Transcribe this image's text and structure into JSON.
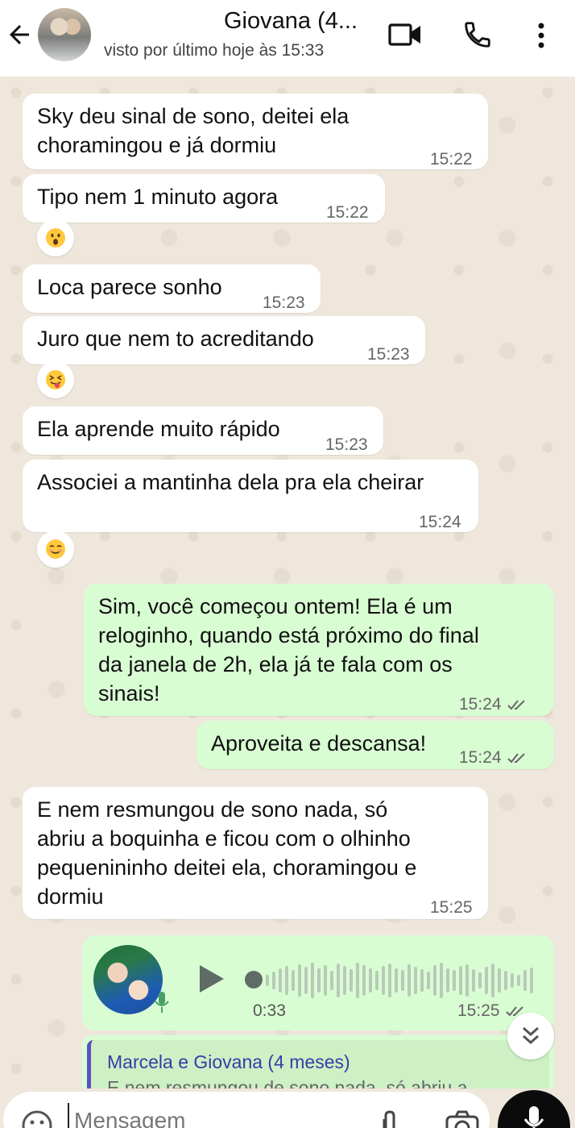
{
  "header": {
    "title": "Giovana (4...",
    "status": "visto por último hoje às 15:33"
  },
  "messages": [
    {
      "text": "Sky deu sinal de sono, deitei ela\nchoramingou e já dormiu",
      "time": "15:22"
    },
    {
      "text": "Tipo nem 1 minuto agora",
      "time": "15:22",
      "reaction": "😮"
    },
    {
      "text": "Loca parece sonho",
      "time": "15:23"
    },
    {
      "text": "Juro que nem to acreditando",
      "time": "15:23",
      "reaction": "😝"
    },
    {
      "text": "Ela aprende muito rápido",
      "time": "15:23"
    },
    {
      "text": "Associei a mantinha dela pra ela cheirar",
      "time": "15:24",
      "reaction": "☺️"
    },
    {
      "text": "Sim, você começou ontem! Ela é um\nreloginho, quando está próximo do final\nda janela de 2h, ela já te fala com os\nsinais!",
      "time": "15:24",
      "outgoing": true
    },
    {
      "text": "Aproveita e descansa!",
      "time": "15:24",
      "outgoing": true
    },
    {
      "text": "E nem resmungou de sono nada, só\nabriu a boquinha e ficou com o olhinho\npequenininho deitei ela, choramingou e\ndormiu",
      "time": "15:25"
    }
  ],
  "voice_note": {
    "duration": "0:33",
    "time": "15:25",
    "progress": 0.0
  },
  "reply_preview": {
    "author": "Marcela e Giovana (4 meses)",
    "snippet": "E nem resmungou de sono nada, só abriu a"
  },
  "composer": {
    "placeholder": "Mensagem"
  },
  "colors": {
    "incoming_bubble": "#ffffff",
    "outgoing_bubble": "#d9fdd3",
    "chat_background": "#efe7dc",
    "reply_accent": "#5b4fc6"
  },
  "icons": [
    "back-arrow-icon",
    "video-call-icon",
    "phone-icon",
    "more-vert-icon",
    "play-icon",
    "mic-icon",
    "emoji-icon",
    "attach-icon",
    "camera-icon",
    "chevron-double-down-icon",
    "double-check-icon"
  ]
}
